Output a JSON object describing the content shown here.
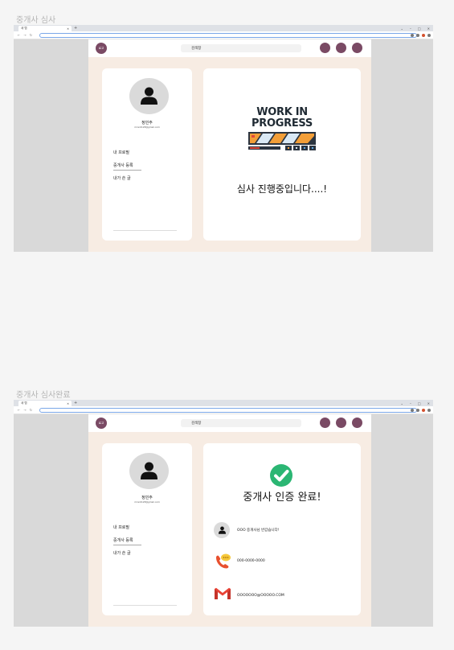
{
  "sections": [
    {
      "title": "중개사 심사",
      "browser": {
        "tab_label": "새 탭"
      },
      "header": {
        "logo": "로고",
        "search_value": "검색창"
      },
      "profile": {
        "name": "정민주",
        "email": "minn0128@gmail.com",
        "menu": [
          "내 프로필",
          "중개사 등록",
          "내가 쓴 글"
        ]
      },
      "main": {
        "wip_line1": "WORK IN",
        "wip_line2": "PROGRESS",
        "message": "심사 진행중입니다....!"
      }
    },
    {
      "title": "중개사 심사완료",
      "browser": {
        "tab_label": "새 탭"
      },
      "header": {
        "logo": "로고",
        "search_value": "검색창"
      },
      "profile": {
        "name": "정민주",
        "email": "minn0128@gmail.com",
        "menu": [
          "내 프로필",
          "중개사 등록",
          "내가 쓴 글"
        ]
      },
      "main": {
        "title": "중개사 인증 완료!",
        "greeting": "OOO 중개사님 반갑습니다!",
        "phone": "000-0000-0000",
        "email": "OOOOOOO@OOOOO.COM"
      }
    }
  ]
}
